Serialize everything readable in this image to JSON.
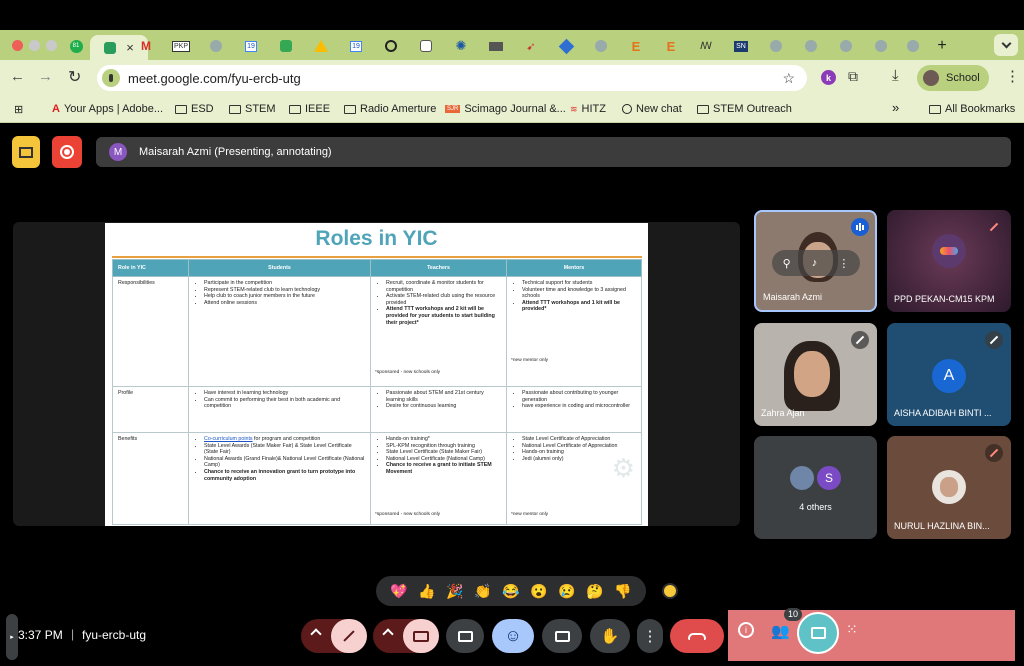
{
  "browser": {
    "url": "meet.google.com/fyu-ercb-utg",
    "profile_label": "School",
    "extension_letter": "k",
    "tab_active_badge": "81",
    "tab_labels": [
      "PKP",
      "19",
      "19",
      "E",
      "E",
      "SN"
    ],
    "bookmarks": [
      "Your Apps | Adobe...",
      "ESD",
      "STEM",
      "IEEE",
      "Radio Amerture",
      "Scimago Journal &...",
      "HITZ",
      "New chat",
      "STEM Outreach"
    ],
    "bookmark_sjr": "SJR",
    "more_bookmarks": "»",
    "all_bookmarks": "All Bookmarks",
    "colors": {
      "tabbar": "#b9d07e",
      "toolbar": "#e8f0cf"
    }
  },
  "meet": {
    "presenter_initial": "M",
    "presenter_banner": "Maisarah Azmi (Presenting, annotating)",
    "time": "3:37 PM",
    "separator": "|",
    "meeting_code": "fyu-ercb-utg",
    "people_count": "10",
    "participants": [
      {
        "name": "Maisarah Azmi",
        "speaking": true
      },
      {
        "name": "PPD PEKAN-CM15 KPM",
        "muted": true
      },
      {
        "name": "Zahra Ajan",
        "muted": true
      },
      {
        "name": "AISHA ADIBAH BINTI ...",
        "initial": "A",
        "muted": true
      },
      {
        "name": "4 others",
        "initial": "S"
      },
      {
        "name": "NURUL HAZLINA BIN...",
        "muted": true
      }
    ],
    "reactions": [
      "💖",
      "👍",
      "🎉",
      "👏",
      "😂",
      "😮",
      "😢",
      "🤔",
      "👎"
    ],
    "colors": {
      "end_call": "#e04b4b",
      "panel": "#e0787a",
      "accent": "#5fc2c6"
    }
  },
  "slide": {
    "title": "Roles in YIC",
    "headers": [
      "Role in YIC",
      "Students",
      "Teachers",
      "Mentors"
    ],
    "rows": [
      {
        "role": "Responsibilities",
        "students": [
          "Participate in the competition",
          "Represent STEM-related club to learn technology",
          "Help club to coach junior members in the future",
          "Attend online sessions"
        ],
        "teachers": [
          "Recruit, coordinate & monitor students for competition",
          "Activate STEM-related club using the resource provided"
        ],
        "teachers_bold": "Attend TTT workshops and 2 kit will be provided for your students to start building their project*",
        "teachers_note": "*sponsored - new schools only",
        "mentors": [
          "Technical support for students",
          "Volunteer time and knowledge to 3 assigned schools"
        ],
        "mentors_bold": "Attend TTT workshops and 1 kit will be provided*",
        "mentors_note": "*new mentor only"
      },
      {
        "role": "Profile",
        "students": [
          "Have interest in learning technology",
          "Can commit to performing their best in both academic and competition"
        ],
        "teachers": [
          "Passionate about STEM and 21st century learning skills",
          "Desire for continuous learning"
        ],
        "mentors": [
          "Passionate about contributing to younger generation",
          "have experience in coding and microcontroller"
        ]
      },
      {
        "role": "Benefits",
        "students_link": "Co-curriculum points",
        "students_link_rest": " for program and competition",
        "students": [
          "State Level Awards (State Maker Fair) & State Level Certificate (State Fair)",
          "National Awards (Grand Finale)& National Level Certificate (National Camp)"
        ],
        "students_bold": "Chance to receive an innovation grant to turn prototype into community adoption",
        "teachers": [
          "Hands-on training*",
          "SPL-KPM recognition through training",
          "State Level Certificate (State Maker Fair)",
          "National Level Certificate (National Camp)"
        ],
        "teachers_bold": "Chance to receive a grant to initiate STEM Movement",
        "teachers_note": "*sponsored - new schools only",
        "mentors": [
          "State Level Certificate of Appreciation",
          "National Level Certificate of Appreciation",
          "Hands-on training",
          "Jedi (alumni only)"
        ],
        "mentors_note": "*new mentor only"
      }
    ]
  }
}
